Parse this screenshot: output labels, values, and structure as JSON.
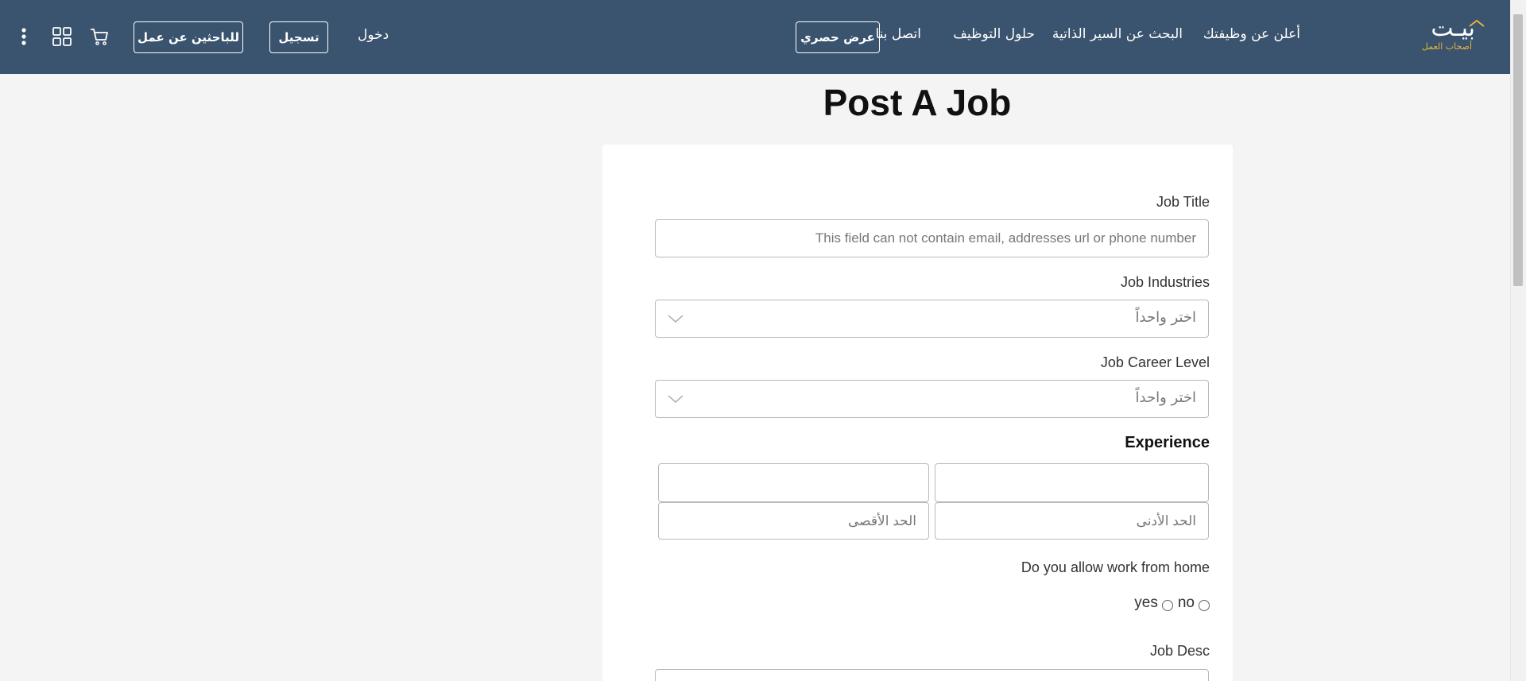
{
  "header": {
    "logo_word": "بيـت",
    "logo_sub": "أصحاب العمل",
    "nav": {
      "post_job": "أعلن عن وظيفتك",
      "cv_search": "البحث عن السير الذاتية",
      "hiring_solutions": "حلول التوظيف",
      "contact": "اتصل بنا"
    },
    "offer_button": "عرض حصري",
    "login": "دخول",
    "register_button": "تسجيل",
    "jobseekers_button": "للباحثين عن عمل",
    "icons": [
      "logo-caret-icon",
      "cart-icon",
      "apps-grid-icon",
      "kebab-menu-icon"
    ],
    "colors": {
      "bar": "#3a536e",
      "accent": "#e9b23a"
    }
  },
  "main": {
    "title": "Post A Job",
    "job_title": {
      "label": "Job Title",
      "placeholder": "This field can not contain email, addresses url or phone number"
    },
    "job_industries": {
      "label": "Job Industries",
      "value": "اختر واحداً"
    },
    "job_career_level": {
      "label": "Job Career Level",
      "value": "اختر واحداً"
    },
    "experience": {
      "label": "Experience",
      "min_placeholder": "الحد الأدنى",
      "max_placeholder": "الحد الأقصى"
    },
    "work_from_home": {
      "label": "Do you allow work from home",
      "options": [
        "yes",
        "no"
      ]
    },
    "job_desc": {
      "label": "Job Desc"
    }
  }
}
